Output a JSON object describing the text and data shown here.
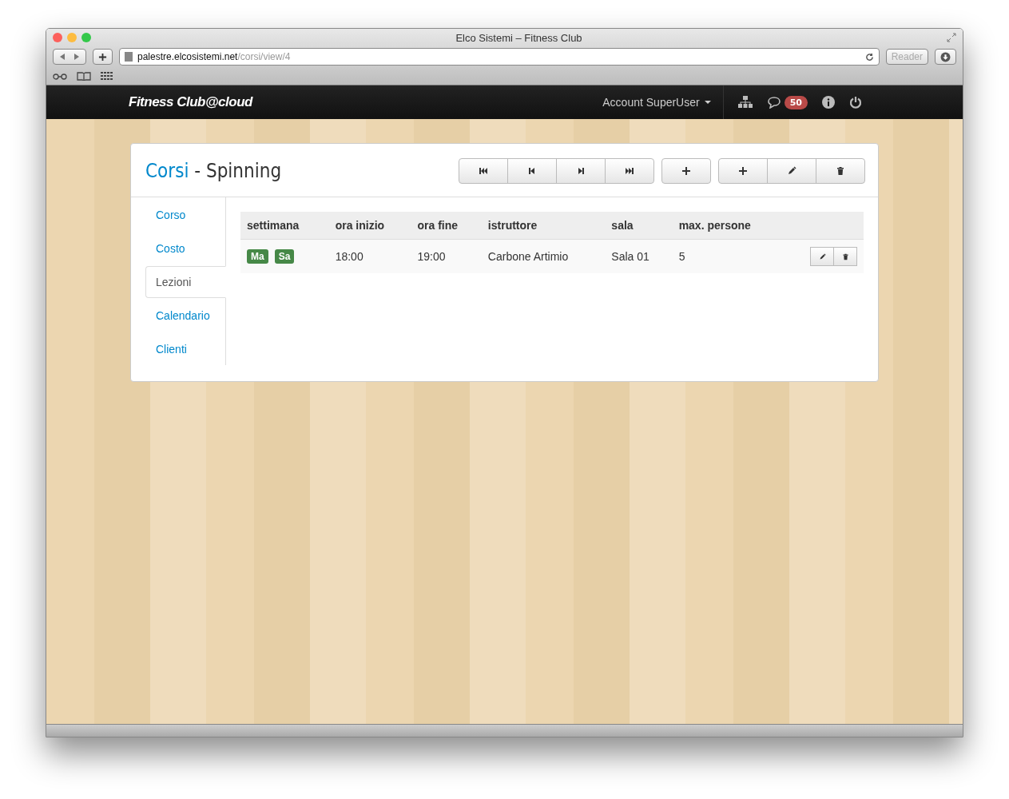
{
  "window": {
    "title": "Elco Sistemi – Fitness Club",
    "url_host": "palestre.elcosistemi.net",
    "url_path": "/corsi/view/4",
    "reader": "Reader"
  },
  "navbar": {
    "brand": "Fitness Club@cloud",
    "account": "Account SuperUser",
    "badge": "50"
  },
  "panel": {
    "title_link": "Corsi",
    "title_rest": " - Spinning",
    "toolbar": [
      [
        {
          "kind": "first"
        },
        {
          "kind": "prev"
        },
        {
          "kind": "next"
        },
        {
          "kind": "last"
        }
      ],
      [
        {
          "kind": "add"
        }
      ],
      [
        {
          "kind": "add"
        },
        {
          "kind": "edit"
        },
        {
          "kind": "delete"
        }
      ]
    ],
    "tabs": [
      {
        "label": "Corso",
        "selected": false
      },
      {
        "label": "Costo",
        "selected": false
      },
      {
        "label": "Lezioni",
        "selected": true
      },
      {
        "label": "Calendario",
        "selected": false
      },
      {
        "label": "Clienti",
        "selected": false
      }
    ],
    "table": {
      "columns": [
        "settimana",
        "ora inizio",
        "ora fine",
        "istruttore",
        "sala",
        "max. persone"
      ],
      "rows": [
        {
          "cells": [
            {
              "badges": [
                "Ma",
                "Sa"
              ]
            },
            {
              "text": "18:00"
            },
            {
              "text": "19:00"
            },
            {
              "text": "Carbone Artimio"
            },
            {
              "text": "Sala 01"
            },
            {
              "text": "5"
            }
          ],
          "actions": [
            {
              "kind": "edit"
            },
            {
              "kind": "delete"
            }
          ]
        }
      ]
    }
  }
}
